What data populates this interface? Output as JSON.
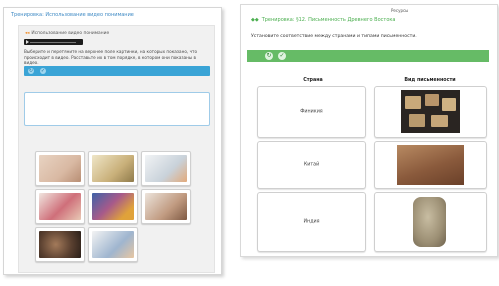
{
  "left": {
    "title": "Тренировка: Использование видео понимание",
    "breadcrumb": "Использование видео понимание",
    "instruction": "Выберите и перетяните на верхнее поле картинки, на которых показано, что происходит в видео. Расставьте их в том порядке, в котором они показаны в видео.",
    "tiles": [
      {
        "icon": "photo-kitchen-hands",
        "color": "#d9b9a3"
      },
      {
        "icon": "photo-child-cooking",
        "color": "#c9b07a"
      },
      {
        "icon": "photo-boy-thumbs-up",
        "color": "#c9d2da"
      },
      {
        "icon": "photo-girl-pink",
        "color": "#cf6f7a"
      },
      {
        "icon": "photo-children-group",
        "color": "#a75a8a"
      },
      {
        "icon": "photo-man-reading",
        "color": "#c09a80"
      },
      {
        "icon": "photo-desserts-plate",
        "color": "#5a4030"
      },
      {
        "icon": "photo-girl-table",
        "color": "#9fb5cf"
      }
    ]
  },
  "right": {
    "top_text": "Ресурсы",
    "title": "Тренировка: §12. Письменность Древнего Востока",
    "instruction": "Установите соответствие между странами и типами письменности.",
    "col_country": "Страна",
    "col_writing": "Вид письменности",
    "rows": [
      {
        "country": "Финикия",
        "image": "tablet-phoenician-script",
        "color": "#2a2522"
      },
      {
        "country": "Китай",
        "image": "bamboo-chinese-script",
        "color": "#8a5a3c"
      },
      {
        "country": "Индия",
        "image": "stone-indian-script",
        "color": "#9c8f74"
      }
    ]
  }
}
